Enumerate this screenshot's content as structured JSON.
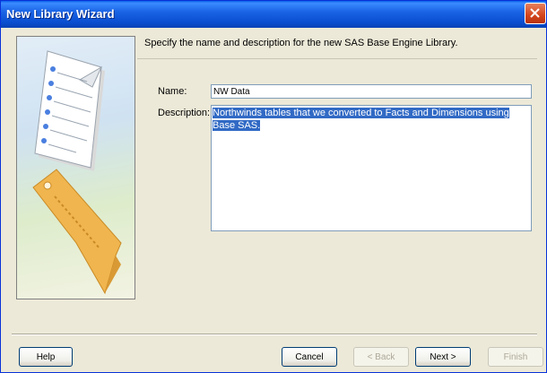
{
  "window": {
    "title": "New Library Wizard"
  },
  "heading": "Specify the name and description for the new SAS Base Engine Library.",
  "form": {
    "name_label": "Name:",
    "name_value": "NW Data",
    "description_label": "Description:",
    "description_value": "Northwinds tables that we converted to Facts and Dimensions using Base SAS."
  },
  "buttons": {
    "help": "Help",
    "cancel": "Cancel",
    "back": "< Back",
    "next": "Next >",
    "finish": "Finish"
  },
  "colors": {
    "titlebar": "#0A4ED0",
    "selection": "#316AC5",
    "dialog_bg": "#ECE9D8"
  }
}
